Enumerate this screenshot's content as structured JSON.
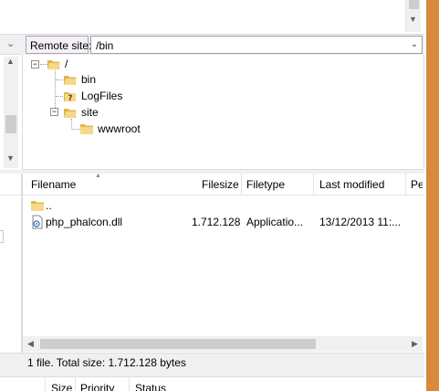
{
  "remote_site": {
    "label": "Remote site:",
    "path": "/bin"
  },
  "tree": {
    "root": "/",
    "items": [
      {
        "label": "bin",
        "icon": "folder-icon"
      },
      {
        "label": "LogFiles",
        "icon": "unknown-folder-icon"
      },
      {
        "label": "site",
        "icon": "folder-icon"
      },
      {
        "label": "wwwroot",
        "icon": "folder-icon"
      }
    ]
  },
  "file_list": {
    "columns": [
      "Filename",
      "Filesize",
      "Filetype",
      "Last modified",
      "Pe"
    ],
    "rows": [
      {
        "name": "..",
        "size": "",
        "type": "",
        "modified": ""
      },
      {
        "name": "php_phalcon.dll",
        "size": "1.712.128",
        "type": "Applicatio...",
        "modified": "13/12/2013 11:..."
      }
    ]
  },
  "status": {
    "text": "1 file. Total size: 1.712.128 bytes"
  },
  "queue": {
    "columns": [
      "Size",
      "Priority",
      "Status"
    ]
  },
  "colors": {
    "label_border": "#b3a1b9",
    "folder": "#e8c15a",
    "side_accent": "#d7893c",
    "scroll_thumb": "#cdcdcd"
  }
}
